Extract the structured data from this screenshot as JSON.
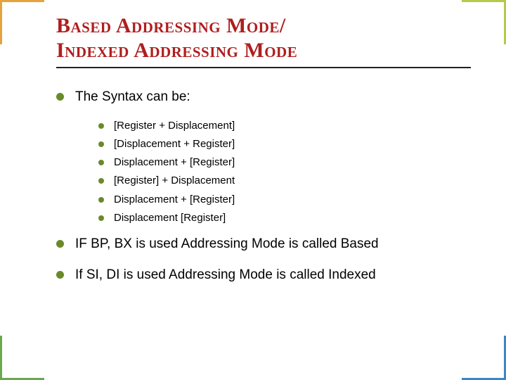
{
  "title_lines": [
    "Based Addressing Mode/",
    "Indexed Addressing Mode"
  ],
  "bullets": {
    "syntax_intro": "The Syntax can be:",
    "syntax_forms": [
      "[Register + Displacement]",
      "[Displacement + Register]",
      "Displacement + [Register]",
      "[Register] + Displacement",
      "Displacement + [Register]",
      "Displacement [Register]"
    ],
    "based_note": "IF BP, BX is used Addressing Mode is called Based",
    "indexed_note": "If SI, DI is used Addressing Mode is called Indexed"
  }
}
